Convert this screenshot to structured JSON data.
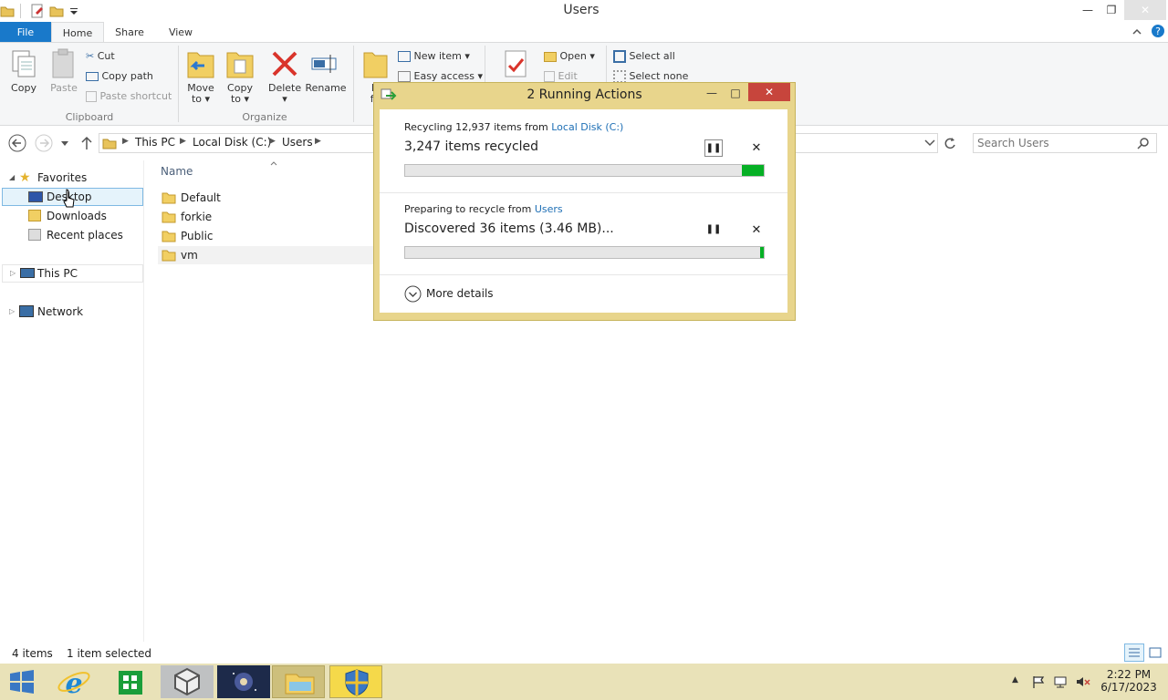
{
  "window": {
    "title": "Users"
  },
  "ribbon": {
    "tabs": [
      {
        "label": "File"
      },
      {
        "label": "Home"
      },
      {
        "label": "Share"
      },
      {
        "label": "View"
      }
    ],
    "clipboard": {
      "copy": "Copy",
      "paste": "Paste",
      "cut": "Cut",
      "copy_path": "Copy path",
      "paste_shortcut": "Paste shortcut",
      "group": "Clipboard"
    },
    "organize": {
      "move_to_1": "Move",
      "move_to_2": "to",
      "copy_to_1": "Copy",
      "copy_to_2": "to",
      "delete": "Delete",
      "rename": "Rename",
      "group": "Organize"
    },
    "new": {
      "new_folder_1": "N",
      "new_folder_2": "fo",
      "new_item": "New item",
      "easy_access": "Easy access"
    },
    "open": {
      "open": "Open",
      "edit": "Edit"
    },
    "select": {
      "select_all": "Select all",
      "select_none": "Select none"
    }
  },
  "address": {
    "path": [
      "This PC",
      "Local Disk (C:)",
      "Users"
    ],
    "search_placeholder": "Search Users"
  },
  "nav": {
    "favorites": "Favorites",
    "items": [
      {
        "label": "Desktop"
      },
      {
        "label": "Downloads"
      },
      {
        "label": "Recent places"
      }
    ],
    "this_pc": "This PC",
    "network": "Network"
  },
  "filelist": {
    "column_name": "Name",
    "items": [
      {
        "name": "Default"
      },
      {
        "name": "forkie"
      },
      {
        "name": "Public"
      },
      {
        "name": "vm"
      }
    ]
  },
  "status": {
    "count": "4 items",
    "selected": "1 item selected"
  },
  "dialog": {
    "title": "2 Running Actions",
    "op1": {
      "prefix": "Recycling 12,937 items from ",
      "link": "Local Disk (C:)",
      "main": "3,247 items recycled",
      "progress": 0.06
    },
    "op2": {
      "prefix": "Preparing to recycle from ",
      "link": "Users",
      "main": "Discovered 36 items (3.46 MB)...",
      "progress": 0.01
    },
    "more_details": "More details"
  },
  "clock": {
    "time": "2:22 PM",
    "date": "6/17/2023"
  },
  "colors": {
    "accent": "#1979ca",
    "progress": "#06b025",
    "dialog_frame": "#e8d58c",
    "taskbar": "#e9e2b8",
    "close_red": "#c7453c"
  }
}
